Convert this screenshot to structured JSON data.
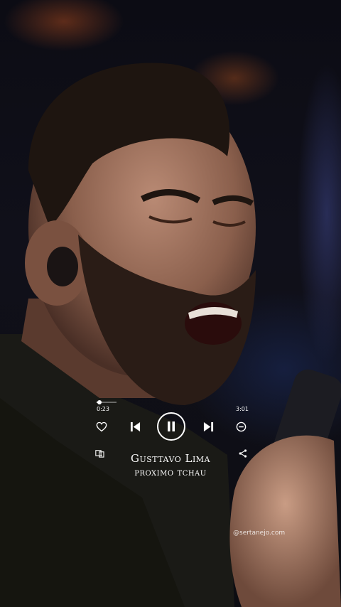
{
  "player": {
    "current_time": "0:23",
    "total_time": "3:01",
    "progress_fraction": 0.13,
    "artist": "Gusttavo Lima",
    "title": "proximo tchau"
  },
  "watermark": "@sertanejo.com",
  "icons": {
    "like": "heart-icon",
    "previous": "skip-previous-icon",
    "play_pause": "pause-icon",
    "next": "skip-next-icon",
    "remove": "minus-circle-icon",
    "cast": "device-cast-icon",
    "share": "share-icon"
  },
  "colors": {
    "controls": "#ffffff"
  }
}
